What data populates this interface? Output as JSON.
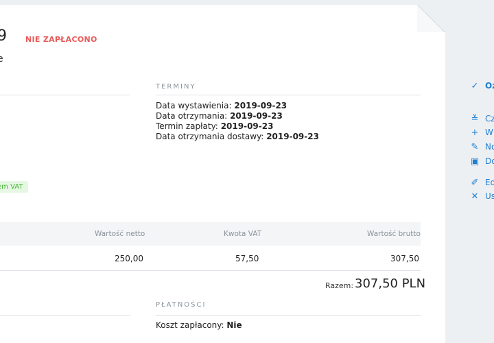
{
  "invoice": {
    "number_tail": "9",
    "subtitle_tail": "e",
    "status": "NIE ZAPŁACONO",
    "vat_badge": "em VAT"
  },
  "terms": {
    "title": "TERMINY",
    "rows": [
      {
        "label": "Data wystawienia:",
        "value": "2019-09-23"
      },
      {
        "label": "Data otrzymania:",
        "value": "2019-09-23"
      },
      {
        "label": "Termin zapłaty:",
        "value": "2019-09-23"
      },
      {
        "label": "Data otrzymania dostawy:",
        "value": "2019-09-23"
      }
    ]
  },
  "table": {
    "headers": {
      "net": "Wartość netto",
      "vat": "Kwota VAT",
      "gross": "Wartość brutto"
    },
    "row": {
      "net": "250,00",
      "vat": "57,50",
      "gross": "307,50"
    }
  },
  "total": {
    "label": "Razem:",
    "value": "307,50 PLN"
  },
  "payments": {
    "title": "PŁATNOŚCI",
    "paid_label": "Koszt zapłacony:",
    "paid_value": "Nie"
  },
  "actions": [
    {
      "icon": "check-icon",
      "label": "Oz",
      "glyph": "✓"
    },
    {
      "icon": "checklist-icon",
      "label": "Cz",
      "glyph": "≚"
    },
    {
      "icon": "plus-icon",
      "label": "W",
      "glyph": "+"
    },
    {
      "icon": "edit-note-icon",
      "label": "No",
      "glyph": "✎"
    },
    {
      "icon": "document-icon",
      "label": "Do",
      "glyph": "▣"
    },
    {
      "icon": "pencil-icon",
      "label": "Ed",
      "glyph": "✐"
    },
    {
      "icon": "close-icon",
      "label": "Us",
      "glyph": "✕"
    }
  ],
  "colors": {
    "accent": "#1f7fd0",
    "unpaid": "#e85a5a",
    "vat_green": "#4ab63a"
  }
}
